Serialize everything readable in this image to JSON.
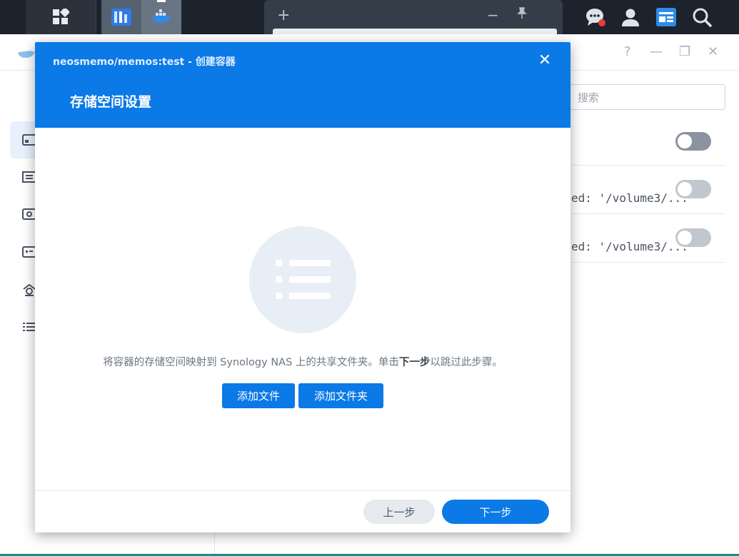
{
  "taskbar": {
    "main_menu_icon": "grid-icon",
    "apps": [
      "package-center-icon",
      "container-manager-icon"
    ],
    "tab_new_symbol": "+",
    "tab_minimize_symbol": "−",
    "right_icons": [
      "chat-icon",
      "user-icon",
      "widgets-icon",
      "search-icon"
    ]
  },
  "background_window": {
    "controls": {
      "help": "?",
      "minimize": "—",
      "restore": "❐",
      "close": "✕"
    },
    "search_placeholder": "搜索",
    "rows": [
      {
        "text": "",
        "enabled": false
      },
      {
        "text": "ed: '/volume3/...",
        "enabled": false
      },
      {
        "text": "ed: '/volume3/...",
        "enabled": false
      }
    ]
  },
  "modal": {
    "breadcrumb": "neosmemo/memos:test - 创建容器",
    "close_symbol": "✕",
    "title": "存储空间设置",
    "description_before": "将容器的存储空间映射到 Synology NAS 上的共享文件夹。单击",
    "description_bold": "下一步",
    "description_after": "以跳过此步骤。",
    "add_file_label": "添加文件",
    "add_folder_label": "添加文件夹",
    "prev_label": "上一步",
    "next_label": "下一步"
  },
  "colors": {
    "accent": "#0b79e6",
    "taskbar": "#1c232d",
    "empty_icon_bg": "#e8eef5"
  }
}
